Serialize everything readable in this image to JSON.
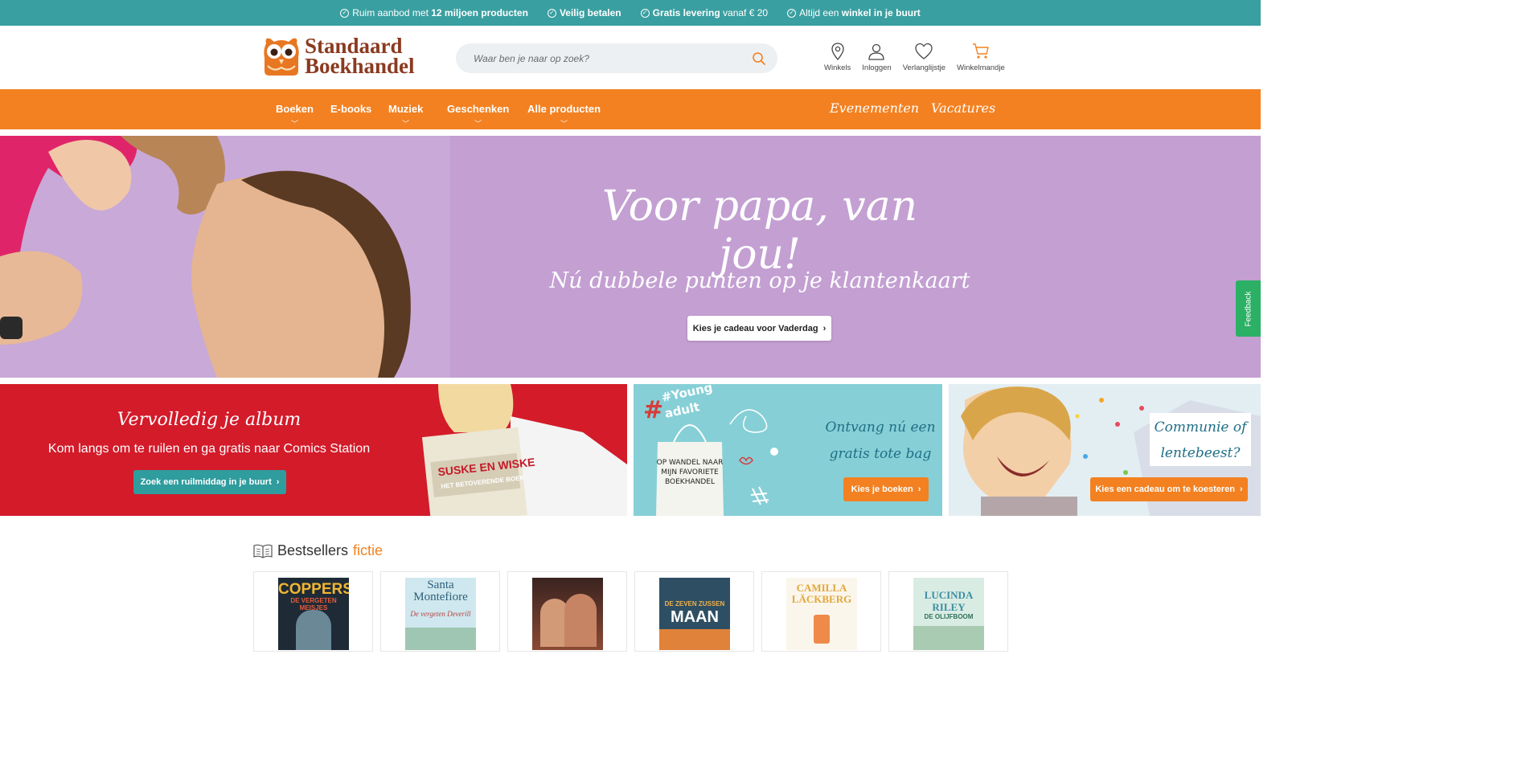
{
  "usp": [
    {
      "pre": "Ruim aanbod met ",
      "bold": "12 miljoen producten",
      "post": ""
    },
    {
      "pre": "",
      "bold": "Veilig betalen",
      "post": ""
    },
    {
      "pre": "",
      "bold": "Gratis levering",
      "post": " vanaf € 20"
    },
    {
      "pre": "Altijd een ",
      "bold": "winkel in je buurt",
      "post": ""
    }
  ],
  "logo": {
    "line1": "Standaard",
    "line2": "Boekhandel"
  },
  "search": {
    "placeholder": "Waar ben je naar op zoek?"
  },
  "header_icons": {
    "stores": "Winkels",
    "login": "Inloggen",
    "wishlist": "Verlanglijstje",
    "cart": "Winkelmandje"
  },
  "nav": {
    "books": "Boeken",
    "ebooks": "E-books",
    "music": "Muziek",
    "gifts": "Geschenken",
    "all": "Alle producten",
    "events": "Evenementen",
    "jobs": "Vacatures"
  },
  "hero": {
    "title": "Voor papa, van jou!",
    "subtitle": "Nú dubbele punten op je klantenkaart",
    "button": "Kies je cadeau voor Vaderdag"
  },
  "feedback": "Feedback",
  "promo_red": {
    "title": "Vervolledig je album",
    "subtitle": "Kom langs om te ruilen en ga gratis naar Comics Station",
    "button": "Zoek een ruilmiddag in je buurt",
    "comic_line1": "SUSKE EN WISKE",
    "comic_line2": "HET BETOVERENDE BOEK"
  },
  "promo_teal": {
    "tag_line1": "#Young",
    "tag_line2": "adult",
    "bag_line1": "OP WANDEL NAAR",
    "bag_line2": "MIJN FAVORIETE",
    "bag_line3": "BOEKHANDEL",
    "line1": "Ontvang nú een",
    "line2": "gratis tote bag",
    "button": "Kies je boeken"
  },
  "promo_comm": {
    "line1": "Communie of",
    "line2": "lentebeest?",
    "button": "Kies een cadeau om te koesteren"
  },
  "bestsellers": {
    "title": "Bestsellers",
    "accent": "fictie"
  },
  "books": [
    {
      "cover_text": "COPPERS",
      "sub": "DE VERGETEN MEISJES"
    },
    {
      "cover_text": "Santa Montefiore",
      "sub": "De vergeten Deverill"
    },
    {
      "cover_text": "",
      "sub": ""
    },
    {
      "cover_text": "MAAN",
      "sub": "DE ZEVEN ZUSSEN"
    },
    {
      "cover_text": "CAMILLA LÄCKBERG",
      "sub": ""
    },
    {
      "cover_text": "LUCINDA RILEY",
      "sub": "DE OLIJFBOOM"
    }
  ]
}
